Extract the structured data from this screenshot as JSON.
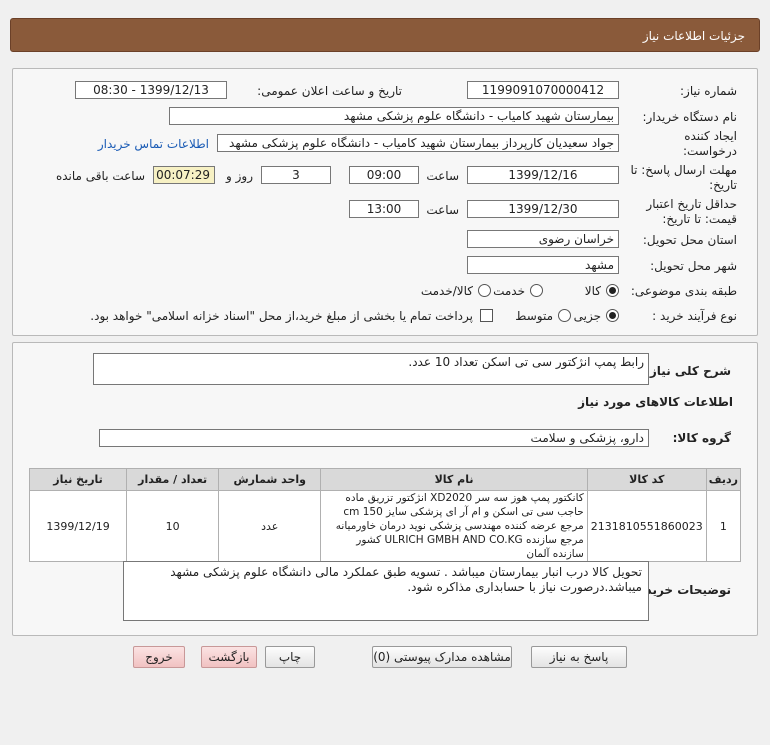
{
  "header": {
    "title": "جزئیات اطلاعات نیاز"
  },
  "form": {
    "need_number_label": "شماره نیاز:",
    "need_number": "1199091070000412",
    "announce_label": "تاریخ و ساعت اعلان عمومی:",
    "announce_value": "1399/12/13 - 08:30",
    "buyer_org_label": "نام دستگاه خریدار:",
    "buyer_org": "بیمارستان شهید کامیاب - دانشگاه علوم پزشکی مشهد",
    "creator_label": "ایجاد کننده درخواست:",
    "creator": "جواد سعیدیان کارپرداز بیمارستان شهید کامیاب - دانشگاه علوم پزشکی مشهد",
    "contact_link": "اطلاعات تماس خریدار",
    "deadline_label": "مهلت ارسال پاسخ: تا تاریخ:",
    "deadline_date": "1399/12/16",
    "time_label": "ساعت",
    "deadline_time": "09:00",
    "days_value": "3",
    "days_label": "روز و",
    "remaining_time": "00:07:29",
    "remaining_label": "ساعت باقی مانده",
    "validity_label": "حداقل تاریخ اعتبار قیمت: تا تاریخ:",
    "validity_date": "1399/12/30",
    "validity_time": "13:00",
    "province_label": "استان محل تحویل:",
    "province": "خراسان رضوی",
    "city_label": "شهر محل تحویل:",
    "city": "مشهد",
    "category_label": "طبقه بندی موضوعی:",
    "category_options": [
      "کالا",
      "خدمت",
      "کالا/خدمت"
    ],
    "process_label": "نوع فرآیند خرید :",
    "process_options": [
      "جزیی",
      "متوسط"
    ],
    "payment_note": "پرداخت تمام یا بخشی از مبلغ خرید،از محل \"اسناد خزانه اسلامی\" خواهد بود."
  },
  "details": {
    "summary_label": "شرح کلی نیاز:",
    "summary": "رابط پمپ انژکتور سی تی اسکن تعداد 10 عدد.",
    "goods_info_title": "اطلاعات کالاهای مورد نیاز",
    "goods_group_label": "گروه کالا:",
    "goods_group": "دارو، پزشکی و سلامت",
    "table": {
      "headers": [
        "ردیف",
        "کد کالا",
        "نام کالا",
        "واحد شمارش",
        "تعداد / مقدار",
        "تاریخ نیاز"
      ],
      "rows": [
        {
          "row": "1",
          "code": "2131810551860023",
          "name": "کانکتور پمپ هوز سه سر XD2020 انژکتور تزریق ماده حاجب سی تی اسکن و ام آر ای پزشکی سایز cm 150 مرجع عرضه کننده مهندسی پزشکی نوید درمان خاورمیانه مرجع سازنده ULRICH GMBH AND CO.KG کشور سازنده آلمان",
          "unit": "عدد",
          "qty": "10",
          "date": "1399/12/19"
        }
      ]
    },
    "buyer_notes_label": "توضیحات خریدار:",
    "buyer_notes": "تحویل کالا درب انبار بیمارستان میباشد . تسویه طبق عملکرد مالی دانشگاه علوم پزشکی مشهد میباشد.درصورت نیاز با حسابداری مذاکره شود."
  },
  "buttons": {
    "reply": "پاسخ به نیاز",
    "attachments": "مشاهده مدارک پیوستی (0)",
    "print": "چاپ",
    "back": "بازگشت",
    "exit": "خروج"
  }
}
